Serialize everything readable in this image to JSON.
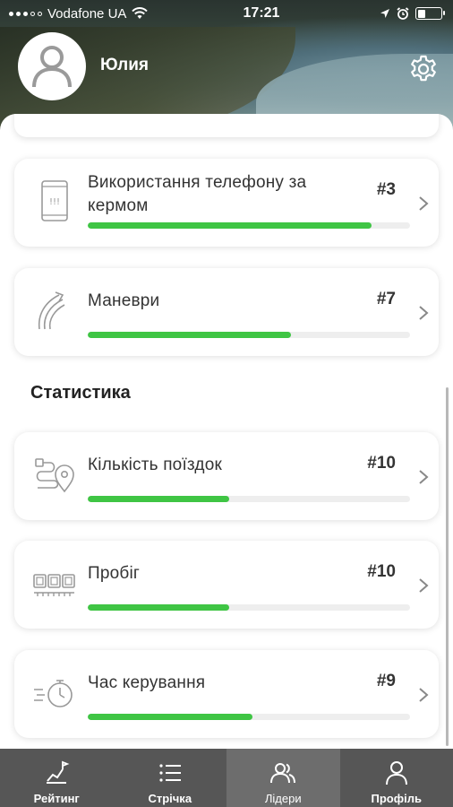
{
  "status_bar": {
    "carrier": "Vodafone UA",
    "time": "17:21"
  },
  "profile": {
    "name": "Юлия"
  },
  "cards_top": [
    {
      "title": "Використання телефону за кермом",
      "rank": "#3",
      "progress": 0.88,
      "icon": "phone-icon"
    },
    {
      "title": "Маневри",
      "rank": "#7",
      "progress": 0.63,
      "icon": "maneuver-icon"
    }
  ],
  "section": {
    "title": "Статистика"
  },
  "cards_stats": [
    {
      "title": "Кількість поїздок",
      "rank": "#10",
      "progress": 0.44,
      "icon": "trips-route-icon"
    },
    {
      "title": "Пробіг",
      "rank": "#10",
      "progress": 0.44,
      "icon": "odometer-icon"
    },
    {
      "title": "Час керування",
      "rank": "#9",
      "progress": 0.51,
      "icon": "stopwatch-icon"
    }
  ],
  "tabbar": {
    "items": [
      {
        "label": "Рейтинг",
        "icon": "rating-chart-icon",
        "active": false
      },
      {
        "label": "Стрічка",
        "icon": "list-feed-icon",
        "active": false
      },
      {
        "label": "Лідери",
        "icon": "leaders-people-icon",
        "active": true
      },
      {
        "label": "Профіль",
        "icon": "profile-person-icon",
        "active": false
      }
    ]
  },
  "colors": {
    "accent_green": "#3fc544",
    "tabbar_bg": "#565656",
    "tabbar_active": "#6d6d6d",
    "text": "#333333"
  }
}
